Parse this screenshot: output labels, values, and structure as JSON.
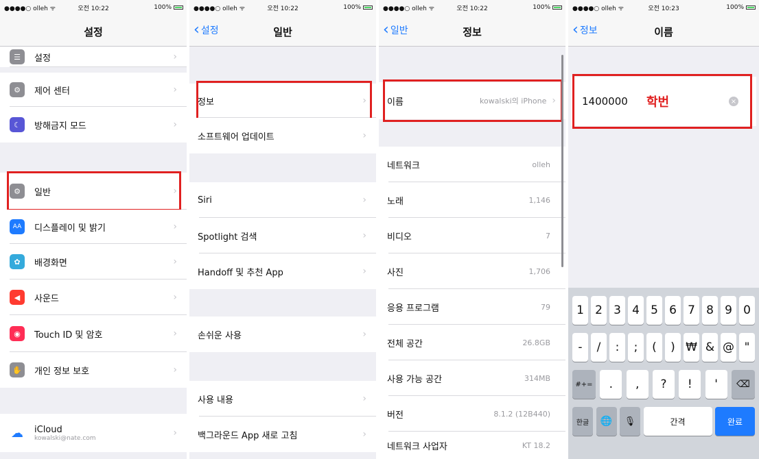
{
  "status": {
    "carrier": "●●●●○ olleh ᯤ",
    "time1": "오전 10:22",
    "time2": "오전 10:22",
    "time3": "오전 10:22",
    "time4": "오전 10:23",
    "battery": "100%"
  },
  "screen1": {
    "title": "설정",
    "items": [
      {
        "label": "설정",
        "icon": "☰",
        "color": "#8e8e93"
      },
      {
        "label": "제어 센터",
        "icon": "⚙",
        "color": "#8e8e93"
      },
      {
        "label": "방해금지 모드",
        "icon": "☾",
        "color": "#5856d6"
      },
      {
        "label": "일반",
        "icon": "⚙",
        "color": "#8e8e93"
      },
      {
        "label": "디스플레이 및 밝기",
        "icon": "AA",
        "color": "#1e7bff"
      },
      {
        "label": "배경화면",
        "icon": "✿",
        "color": "#34aadc"
      },
      {
        "label": "사운드",
        "icon": "◀",
        "color": "#ff3b30"
      },
      {
        "label": "Touch ID 및 암호",
        "icon": "◉",
        "color": "#ff2d55"
      },
      {
        "label": "개인 정보 보호",
        "icon": "✋",
        "color": "#8e8e93"
      },
      {
        "label": "iCloud",
        "sub": "kowalski@nate.com",
        "icon": "☁",
        "color": "#ffffff"
      }
    ]
  },
  "screen2": {
    "back": "설정",
    "title": "일반",
    "items": [
      {
        "label": "정보"
      },
      {
        "label": "소프트웨어 업데이트"
      },
      {
        "label": "Siri"
      },
      {
        "label": "Spotlight 검색"
      },
      {
        "label": "Handoff 및 추천 App"
      },
      {
        "label": "손쉬운 사용"
      },
      {
        "label": "사용 내용"
      },
      {
        "label": "백그라운드 App 새로 고침"
      }
    ]
  },
  "screen3": {
    "back": "일반",
    "title": "정보",
    "items": [
      {
        "label": "이름",
        "value": "kowalski의 iPhone"
      },
      {
        "label": "네트워크",
        "value": "olleh"
      },
      {
        "label": "노래",
        "value": "1,146"
      },
      {
        "label": "비디오",
        "value": "7"
      },
      {
        "label": "사진",
        "value": "1,706"
      },
      {
        "label": "응용 프로그램",
        "value": "79"
      },
      {
        "label": "전체 공간",
        "value": "26.8GB"
      },
      {
        "label": "사용 가능 공간",
        "value": "314MB"
      },
      {
        "label": "버전",
        "value": "8.1.2 (12B440)"
      },
      {
        "label": "네트워크 사업자",
        "value": "KT 18.2"
      }
    ]
  },
  "screen4": {
    "back": "정보",
    "title": "이름",
    "name_value": "1400000",
    "annotation": "학번",
    "keys_row1": [
      "1",
      "2",
      "3",
      "4",
      "5",
      "6",
      "7",
      "8",
      "9",
      "0"
    ],
    "keys_row2": [
      "-",
      "/",
      ":",
      ";",
      "(",
      ")",
      "₩",
      "&",
      "@",
      "\""
    ],
    "keys_row3": [
      "#+=",
      ".",
      ",",
      "?",
      "!",
      "'",
      "⌫"
    ],
    "keys_row4": [
      "한글",
      "🌐",
      "🎙",
      "간격",
      "완료"
    ]
  }
}
